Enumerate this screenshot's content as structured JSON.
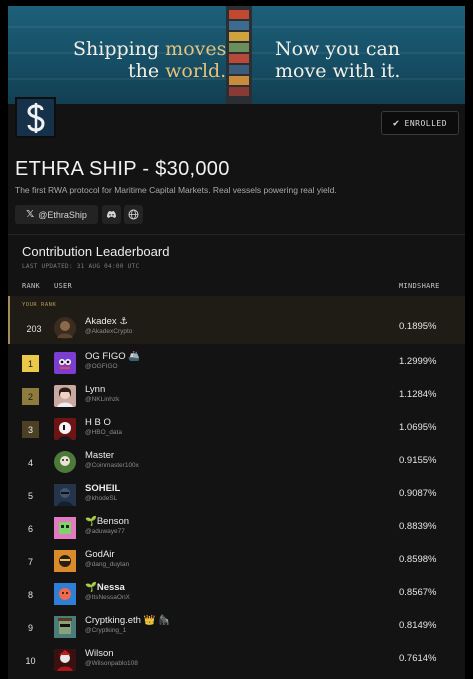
{
  "banner": {
    "left_line1_a": "Shipping ",
    "left_line1_b": "moves",
    "left_line2_a": "the ",
    "left_line2_b": "world.",
    "right_line1": "Now you can",
    "right_line2": "move with it."
  },
  "logo_icon": "dollar-s-logo-icon",
  "enrolled": {
    "label": "ENROLLED",
    "icon": "checkmark-icon"
  },
  "project": {
    "title": "ETHRA SHIP - $30,000",
    "description": "The first RWA protocol for Maritime Capital Markets. Real vessels powering real yield."
  },
  "social": {
    "x_handle": "@EthraShip",
    "x_icon": "x-logo-icon",
    "discord_icon": "discord-icon",
    "web_icon": "globe-icon"
  },
  "leaderboard": {
    "title": "Contribution Leaderboard",
    "updated": "LAST UPDATED: 31 AUG 04:00 UTC",
    "headers": {
      "rank": "RANK",
      "user": "USER",
      "mindshare": "MINDSHARE"
    },
    "your_rank_label": "YOUR RANK",
    "your_rank": {
      "rank": "203",
      "name": "Akadex ⚓",
      "handle": "@AkadexCrypto",
      "share": "0.1895%"
    },
    "rows": [
      {
        "rank": "1",
        "name": "OG FIGO 🚢",
        "handle": "@OGFIGO",
        "share": "1.2999%"
      },
      {
        "rank": "2",
        "name": "Lynn",
        "handle": "@NKLinhzk",
        "share": "1.1284%"
      },
      {
        "rank": "3",
        "name": "H B O",
        "handle": "@HBO_data",
        "share": "1.0695%"
      },
      {
        "rank": "4",
        "name": "Master",
        "handle": "@Coinmaster100x",
        "share": "0.9155%"
      },
      {
        "rank": "5",
        "name": "SOHEIL",
        "handle": "@khodeSL",
        "share": "0.9087%"
      },
      {
        "rank": "6",
        "name": "🌱Benson",
        "handle": "@aduwaye77",
        "share": "0.8839%"
      },
      {
        "rank": "7",
        "name": "GodAir",
        "handle": "@dang_duytan",
        "share": "0.8598%"
      },
      {
        "rank": "8",
        "name": "🌱Nessa",
        "handle": "@ItsNessaOnX",
        "share": "0.8567%"
      },
      {
        "rank": "9",
        "name": "Cryptking.eth 👑 🦍",
        "handle": "@Cryptking_1",
        "share": "0.8149%"
      },
      {
        "rank": "10",
        "name": "Wilson",
        "handle": "@Wilsonpablo108",
        "share": "0.7614%"
      }
    ]
  },
  "colors": {
    "gold": "#e9c84a",
    "silver": "#8f7b3e",
    "bronze": "#4c4024",
    "accent": "#b79a5b"
  }
}
